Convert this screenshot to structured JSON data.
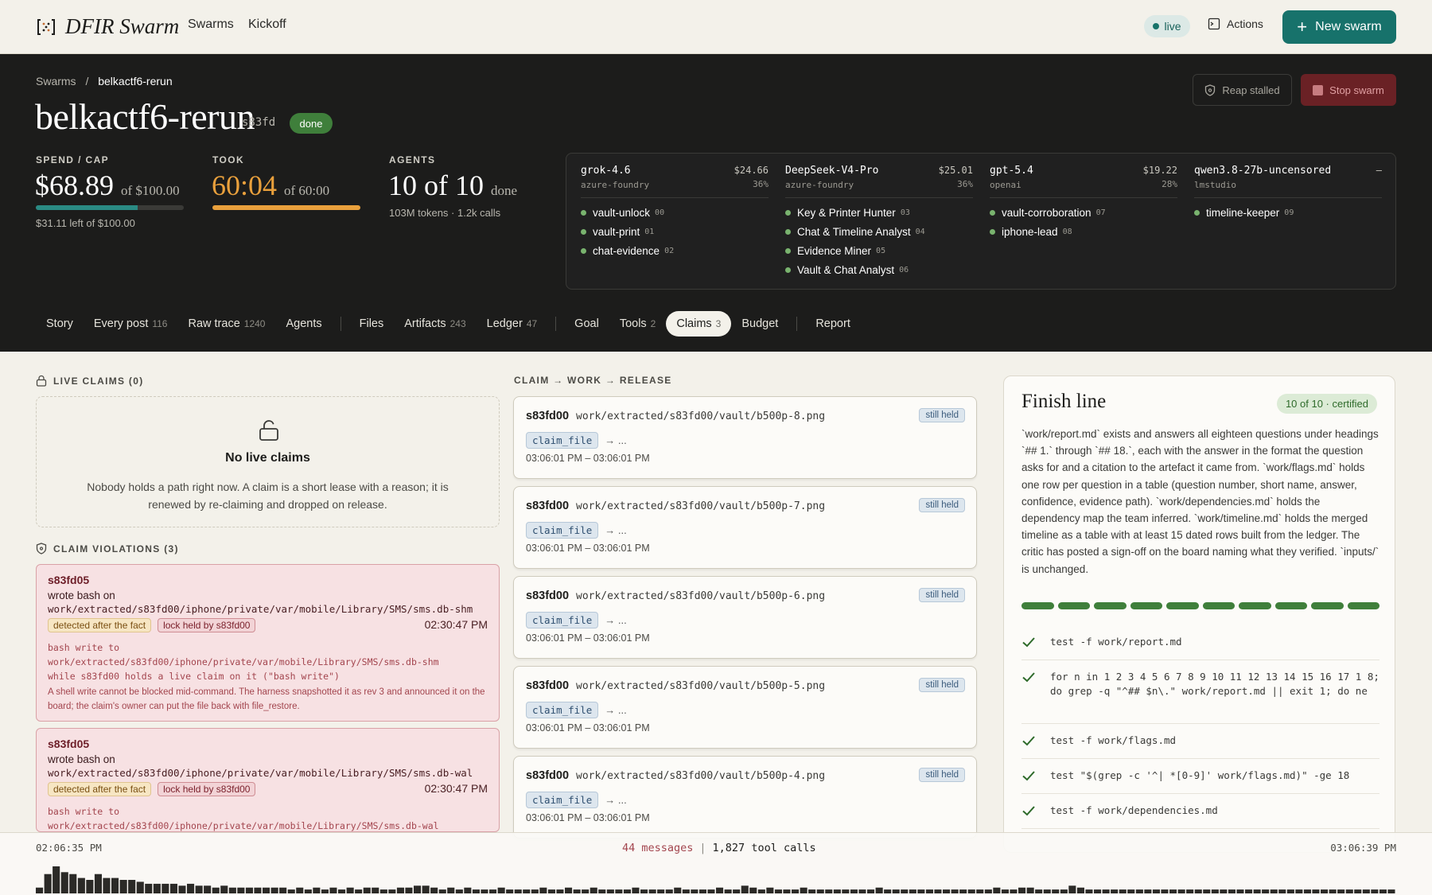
{
  "nav": {
    "app_name": "DFIR Swarm",
    "links": [
      "Swarms",
      "Kickoff"
    ],
    "live_label": "live",
    "actions_label": "Actions",
    "new_swarm_label": "New swarm"
  },
  "header": {
    "breadcrumb_root": "Swarms",
    "breadcrumb_sep": "/",
    "breadcrumb_current": "belkactf6-rerun",
    "title": "belkactf6-rerun",
    "swarm_id": "s83fd",
    "status": "done",
    "reap_label": "Reap stalled",
    "stop_label": "Stop swarm"
  },
  "stats": {
    "spend": {
      "label": "SPEND / CAP",
      "value": "$68.89",
      "suffix": "of $100.00",
      "sub": "$31.11 left of $100.00",
      "fraction": 0.6889,
      "color": "#2a8a83"
    },
    "took": {
      "label": "TOOK",
      "value": "60:04",
      "suffix": "of 60:00",
      "fraction": 1.0,
      "color": "#e9a03c"
    },
    "agents": {
      "label": "AGENTS",
      "value": "10 of 10",
      "suffix": "done",
      "sub": "103M tokens · 1.2k calls"
    }
  },
  "models": [
    {
      "name": "grok-4.6",
      "provider": "azure-foundry",
      "cost": "$24.66",
      "pct": "36%",
      "agents": [
        {
          "name": "vault-unlock",
          "num": "00"
        },
        {
          "name": "vault-print",
          "num": "01"
        },
        {
          "name": "chat-evidence",
          "num": "02"
        }
      ]
    },
    {
      "name": "DeepSeek-V4-Pro",
      "provider": "azure-foundry",
      "cost": "$25.01",
      "pct": "36%",
      "agents": [
        {
          "name": "Key & Printer Hunter",
          "num": "03"
        },
        {
          "name": "Chat & Timeline Analyst",
          "num": "04"
        },
        {
          "name": "Evidence Miner",
          "num": "05"
        },
        {
          "name": "Vault & Chat Analyst",
          "num": "06"
        }
      ]
    },
    {
      "name": "gpt-5.4",
      "provider": "openai",
      "cost": "$19.22",
      "pct": "28%",
      "agents": [
        {
          "name": "vault-corroboration",
          "num": "07"
        },
        {
          "name": "iphone-lead",
          "num": "08"
        }
      ]
    },
    {
      "name": "qwen3.8-27b-uncensored",
      "provider": "lmstudio",
      "cost": "–",
      "pct": "",
      "agents": [
        {
          "name": "timeline-keeper",
          "num": "09"
        }
      ]
    }
  ],
  "tabs": {
    "story": {
      "label": "Story"
    },
    "every_post": {
      "label": "Every post",
      "count": "116"
    },
    "raw_trace": {
      "label": "Raw trace",
      "count": "1240"
    },
    "agents": {
      "label": "Agents"
    },
    "files": {
      "label": "Files"
    },
    "artifacts": {
      "label": "Artifacts",
      "count": "243"
    },
    "ledger": {
      "label": "Ledger",
      "count": "47"
    },
    "goal": {
      "label": "Goal"
    },
    "tools": {
      "label": "Tools",
      "count": "2"
    },
    "claims": {
      "label": "Claims",
      "count": "3"
    },
    "budget": {
      "label": "Budget"
    },
    "report": {
      "label": "Report"
    }
  },
  "live_claims": {
    "label": "LIVE CLAIMS (0)",
    "empty_title": "No live claims",
    "empty_desc": "Nobody holds a path right now. A claim is a short lease with a reason; it is renewed by re-claiming and dropped on release."
  },
  "violations": {
    "label": "CLAIM VIOLATIONS (3)",
    "items": [
      {
        "who": "s83fd05",
        "what": "wrote bash on",
        "path": "work/extracted/s83fd00/iphone/private/var/mobile/Library/SMS/sms.db-shm",
        "tag1": "detected after the fact",
        "tag2": "lock held by s83fd00",
        "time": "02:30:47 PM",
        "msg1": "bash write to",
        "msg2": "work/extracted/s83fd00/iphone/private/var/mobile/Library/SMS/sms.db-shm",
        "msg3": "while s83fd00 holds a live claim on it (\"bash write\")",
        "note": "A shell write cannot be blocked mid-command. The harness snapshotted it as rev 3 and announced it on the board; the claim's owner can put the file back with file_restore."
      },
      {
        "who": "s83fd05",
        "what": "wrote bash on",
        "path": "work/extracted/s83fd00/iphone/private/var/mobile/Library/SMS/sms.db-wal",
        "tag1": "detected after the fact",
        "tag2": "lock held by s83fd00",
        "time": "02:30:47 PM",
        "msg1": "bash write to",
        "msg2": "work/extracted/s83fd00/iphone/private/var/mobile/Library/SMS/sms.db-wal"
      }
    ]
  },
  "claim_flow": {
    "label": "CLAIM → WORK → RELEASE",
    "items": [
      {
        "who": "s83fd00",
        "path": "work/extracted/s83fd00/vault/b500p-8.png",
        "status": "still held",
        "kind": "claim_file",
        "arrow": "→ ...",
        "time": "03:06:01 PM – 03:06:01 PM"
      },
      {
        "who": "s83fd00",
        "path": "work/extracted/s83fd00/vault/b500p-7.png",
        "status": "still held",
        "kind": "claim_file",
        "arrow": "→ ...",
        "time": "03:06:01 PM – 03:06:01 PM"
      },
      {
        "who": "s83fd00",
        "path": "work/extracted/s83fd00/vault/b500p-6.png",
        "status": "still held",
        "kind": "claim_file",
        "arrow": "→ ...",
        "time": "03:06:01 PM – 03:06:01 PM"
      },
      {
        "who": "s83fd00",
        "path": "work/extracted/s83fd00/vault/b500p-5.png",
        "status": "still held",
        "kind": "claim_file",
        "arrow": "→ ...",
        "time": "03:06:01 PM – 03:06:01 PM"
      },
      {
        "who": "s83fd00",
        "path": "work/extracted/s83fd00/vault/b500p-4.png",
        "status": "still held",
        "kind": "claim_file",
        "arrow": "→ ...",
        "time": "03:06:01 PM – 03:06:01 PM"
      }
    ]
  },
  "finish": {
    "title": "Finish line",
    "badge": "10 of 10 · certified",
    "desc": "`work/report.md` exists and answers all eighteen questions under headings `## 1.` through `## 18.`, each with the answer in the format the question asks for and a citation to the artefact it came from. `work/flags.md` holds one row per question in a table (question number, short name, answer, confidence, evidence path). `work/dependencies.md` holds the dependency map the team inferred. `work/timeline.md` holds the merged timeline as a table with at least 15 dated rows built from the ledger. The critic has posted a sign-off on the board naming what they verified. `inputs/` is unchanged.",
    "passed": 10,
    "total": 10,
    "checks": [
      "test -f work/report.md",
      "for n in 1 2 3 4 5 6 7 8 9 10 11 12 13 14 15 16 17 1 8; do grep -q \"^## $n\\.\" work/report.md || exit 1; do ne",
      "test -f work/flags.md",
      "test \"$(grep -c '^| *[0-9]' work/flags.md)\" -ge 18",
      "test -f work/dependencies.md"
    ]
  },
  "timeline": {
    "start": "02:06:35 PM",
    "end": "03:06:39 PM",
    "messages": "44 messages",
    "sep": "|",
    "tool_calls": "1,827 tool calls",
    "activity": [
      3,
      10,
      14,
      11,
      10,
      8,
      7,
      10,
      8,
      8,
      7,
      7,
      6,
      5,
      5,
      5,
      5,
      4,
      5,
      4,
      4,
      3,
      4,
      3,
      3,
      3,
      3,
      3,
      3,
      3,
      2,
      3,
      2,
      3,
      2,
      3,
      2,
      3,
      2,
      3,
      3,
      2,
      2,
      3,
      3,
      4,
      4,
      3,
      2,
      3,
      2,
      3,
      2,
      2,
      2,
      3,
      2,
      2,
      2,
      2,
      3,
      2,
      2,
      3,
      2,
      2,
      3,
      2,
      2,
      2,
      2,
      3,
      2,
      2,
      2,
      2,
      3,
      2,
      2,
      2,
      2,
      3,
      2,
      2,
      4,
      3,
      2,
      3,
      2,
      2,
      2,
      3,
      2,
      2,
      2,
      2,
      2,
      2,
      2,
      2,
      3,
      2,
      2,
      2,
      2,
      2,
      2,
      2,
      2,
      2,
      2,
      2,
      2,
      2,
      3,
      2,
      2,
      3,
      3,
      2,
      2,
      2,
      2,
      4,
      3,
      2,
      2,
      2,
      2,
      2,
      2,
      2,
      2,
      2,
      2,
      2,
      2,
      2,
      2,
      2,
      2,
      2,
      2,
      2,
      2,
      2,
      2,
      2,
      2,
      2,
      2,
      2,
      2,
      2,
      2,
      2,
      2,
      2,
      2,
      2,
      2,
      2
    ]
  }
}
